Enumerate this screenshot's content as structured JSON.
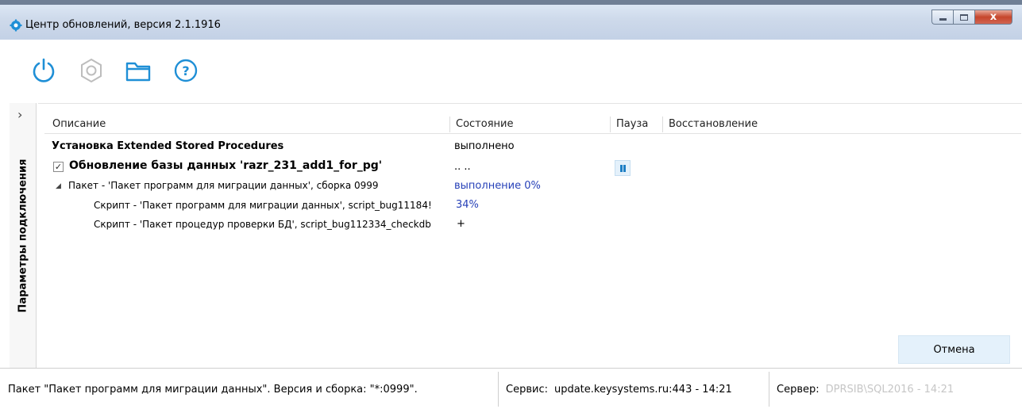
{
  "window": {
    "title": "Центр обновлений, версия 2.1.1916",
    "close_label": "x"
  },
  "toolbar": {
    "buttons": [
      "power-icon",
      "settings-icon",
      "folder-icon",
      "help-icon"
    ],
    "accent": "#1f8fd6"
  },
  "side_panel": {
    "label": "Параметры подключения",
    "chevron": "›"
  },
  "table": {
    "columns": [
      "Описание",
      "Состояние",
      "Пауза",
      "Восстановление"
    ],
    "rows": [
      {
        "description": "Установка Extended Stored Procedures",
        "status": "выполнено"
      },
      {
        "description": "Обновление базы данных 'razr_231_add1_for_pg'",
        "status": "..        ..",
        "checked": "✓"
      },
      {
        "toggle": "◢",
        "description": "Пакет - 'Пакет программ для миграции данных', сборка 0999",
        "status": "выполнение 0%"
      },
      {
        "description": "Скрипт - 'Пакет программ для миграции данных', script_bug11184!",
        "status": "34%"
      },
      {
        "description": "Скрипт - 'Пакет процедур проверки БД', script_bug112334_checkdb",
        "status": "+"
      }
    ]
  },
  "cancel_label": "Отмена",
  "statusbar": {
    "package": "Пакет \"Пакет программ для миграции данных\". Версия и сборка: \"*:0999\".",
    "service_label": "Сервис:",
    "service_value": "update.keysystems.ru:443 - 14:21",
    "server_label": "Сервер:",
    "server_value": "DPRSIB\\SQL2016 - 14:21"
  }
}
